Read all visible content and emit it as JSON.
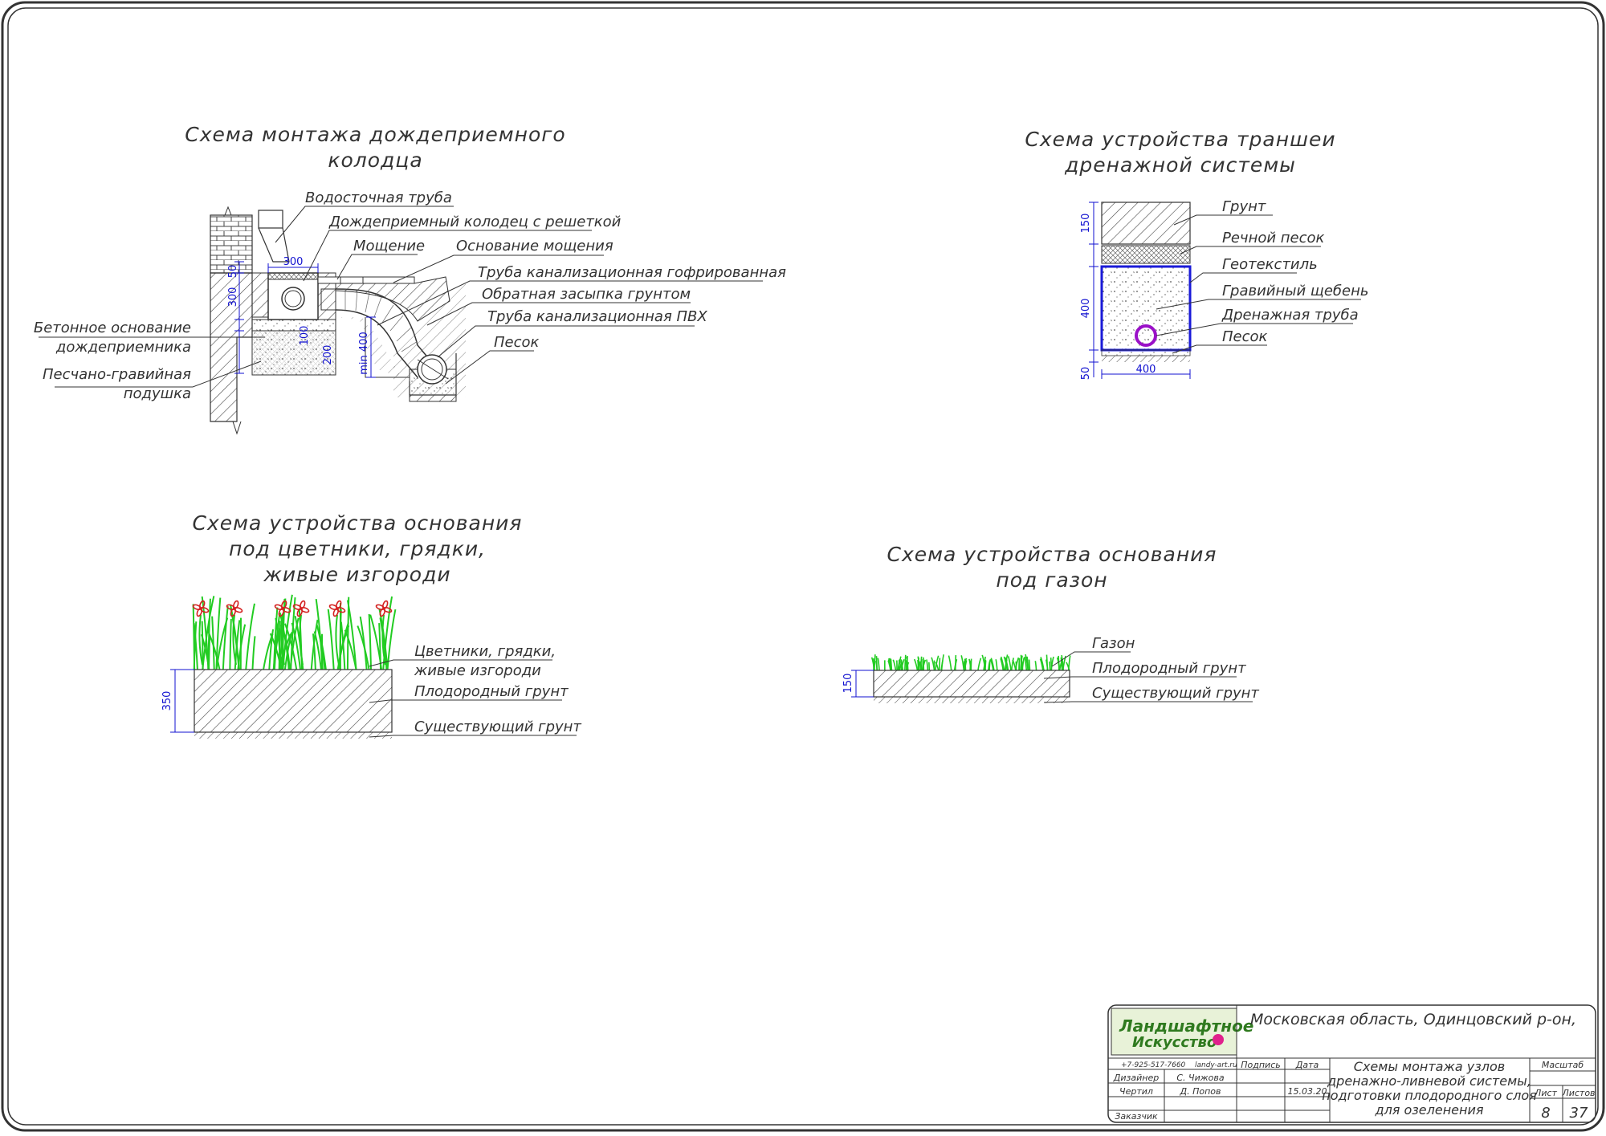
{
  "titles": {
    "well": [
      "Схема монтажа дождеприемного",
      "колодца"
    ],
    "trench": [
      "Схема устройства траншеи",
      "дренажной системы"
    ],
    "beds": [
      "Схема устройства основания",
      "под цветники, грядки,",
      "живые изгороди"
    ],
    "lawn": [
      "Схема устройства основания",
      "под газон"
    ]
  },
  "well": {
    "labels": {
      "downpipe": "Водосточная труба",
      "well_grate": "Дождеприемный колодец с решеткой",
      "paving": "Мощение",
      "paving_base": "Основание мощения",
      "corrugated_pipe": "Труба канализационная гофрированная",
      "backfill": "Обратная засыпка грунтом",
      "pvc_pipe": "Труба канализационная ПВХ",
      "sand": "Песок",
      "concrete_1": "Бетонное основание",
      "concrete_2": "дождеприемника",
      "cushion_1": "Песчано-гравийная",
      "cushion_2": "подушка"
    },
    "dims": {
      "w300": "300",
      "h50": "50",
      "h300": "300",
      "h100": "100",
      "h200": "200",
      "min400": "min 400"
    }
  },
  "trench": {
    "labels": {
      "soil": "Грунт",
      "river_sand": "Речной песок",
      "geotextile": "Геотекстиль",
      "gravel": "Гравийный щебень",
      "drain_pipe": "Дренажная труба",
      "sand": "Песок"
    },
    "dims": {
      "h150": "150",
      "h400": "400",
      "h50": "50",
      "w400": "400"
    }
  },
  "beds": {
    "labels": {
      "beds_1": "Цветники, грядки,",
      "beds_2": "живые изгороди",
      "fertile": "Плодородный грунт",
      "existing": "Существующий грунт"
    },
    "dims": {
      "h350": "350"
    }
  },
  "lawn": {
    "labels": {
      "lawn": "Газон",
      "fertile": "Плодородный грунт",
      "existing": "Существующий грунт"
    },
    "dims": {
      "h150": "150"
    }
  },
  "title_block": {
    "logo_line1": "Ландшафтное",
    "logo_line2": "Искусство",
    "phone": "+7-925-517-7660",
    "site": "landy-art.ru",
    "location": "Московская область, Одинцовский р-он,",
    "sign_header": "Подпись",
    "date_header": "Дата",
    "roles": [
      {
        "role": "Дизайнер",
        "name": "С. Чижова",
        "date": ""
      },
      {
        "role": "Чертил",
        "name": "Д. Попов",
        "date": "15.03.20"
      },
      {
        "role": "Заказчик",
        "name": "",
        "date": ""
      }
    ],
    "drawing_title": [
      "Схемы монтажа узлов",
      "дренажно-ливневой системы,",
      "подготовки плодородного слоя",
      "для озеленения"
    ],
    "scale_label": "Масштаб",
    "sheet_label": "Лист",
    "sheets_label": "Листов",
    "sheet_no": "8",
    "sheets_total": "37"
  },
  "colors": {
    "dimension": "#1010d0",
    "drain_box": "#1a1ad8",
    "drain_pipe": "#9a10c8",
    "grass": "#22cc22",
    "flower": "#d42020",
    "logo_green": "#2f7a1f",
    "logo_dot": "#e0208c"
  }
}
